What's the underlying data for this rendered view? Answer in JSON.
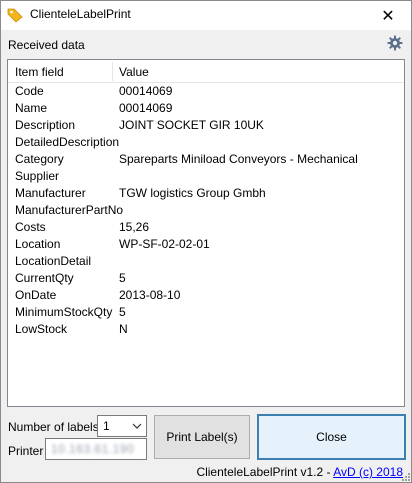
{
  "window": {
    "title": "ClienteleLabelPrint",
    "close_glyph": "✕"
  },
  "section": {
    "label": "Received data"
  },
  "grid": {
    "headers": {
      "field": "Item field",
      "value": "Value"
    },
    "rows": [
      {
        "field": "Code",
        "value": "00014069"
      },
      {
        "field": "Name",
        "value": "00014069"
      },
      {
        "field": "Description",
        "value": "JOINT SOCKET GIR 10UK"
      },
      {
        "field": "DetailedDescription",
        "value": ""
      },
      {
        "field": "Category",
        "value": "Spareparts Miniload Conveyors - Mechanical"
      },
      {
        "field": "Supplier",
        "value": ""
      },
      {
        "field": "Manufacturer",
        "value": "TGW logistics Group Gmbh"
      },
      {
        "field": "ManufacturerPartNo",
        "value": ""
      },
      {
        "field": "Costs",
        "value": "15,26"
      },
      {
        "field": "Location",
        "value": "WP-SF-02-02-01"
      },
      {
        "field": "LocationDetail",
        "value": ""
      },
      {
        "field": "CurrentQty",
        "value": "5"
      },
      {
        "field": "OnDate",
        "value": "2013-08-10"
      },
      {
        "field": "MinimumStockQty",
        "value": "5"
      },
      {
        "field": "LowStock",
        "value": "N"
      }
    ]
  },
  "controls": {
    "number_of_labels_label": "Number of labels",
    "number_of_labels_value": "1",
    "printer_label": "Printer",
    "printer_value": "10.163.61.190",
    "print_button": "Print Label(s)",
    "close_button": "Close"
  },
  "status": {
    "prefix": "ClienteleLabelPrint v1.2 - ",
    "author_link": "AvD (c) 2018"
  },
  "colors": {
    "app_icon": "#f2b51b",
    "link": "#0000ff",
    "focus_border": "#3c7fb1",
    "gear": "#5c6f8c"
  },
  "icons": {
    "app": "tag-icon",
    "settings": "gear-icon",
    "dropdown": "chevron-down-icon",
    "close": "close-icon",
    "resize": "resize-grip-icon"
  }
}
